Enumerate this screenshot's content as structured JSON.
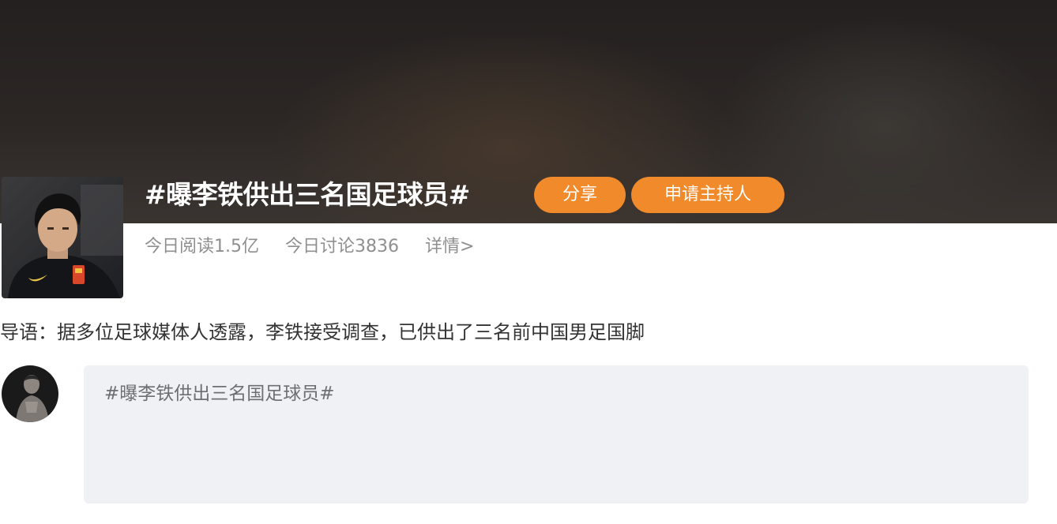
{
  "topic": {
    "title": "#曝李铁供出三名国足球员#",
    "share_label": "分享",
    "host_label": "申请主持人",
    "stats": {
      "read": "今日阅读1.5亿",
      "discuss": "今日讨论3836",
      "details": "详情>"
    },
    "intro": "导语：据多位足球媒体人透露，李铁接受调查，已供出了三名前中国男足国脚"
  },
  "composer": {
    "text": "#曝李铁供出三名国足球员#"
  },
  "colors": {
    "accent": "#f08a2b",
    "banner": "#2c2725",
    "composer_bg": "#f0f1f5",
    "stats_text": "#8f8f8f"
  }
}
